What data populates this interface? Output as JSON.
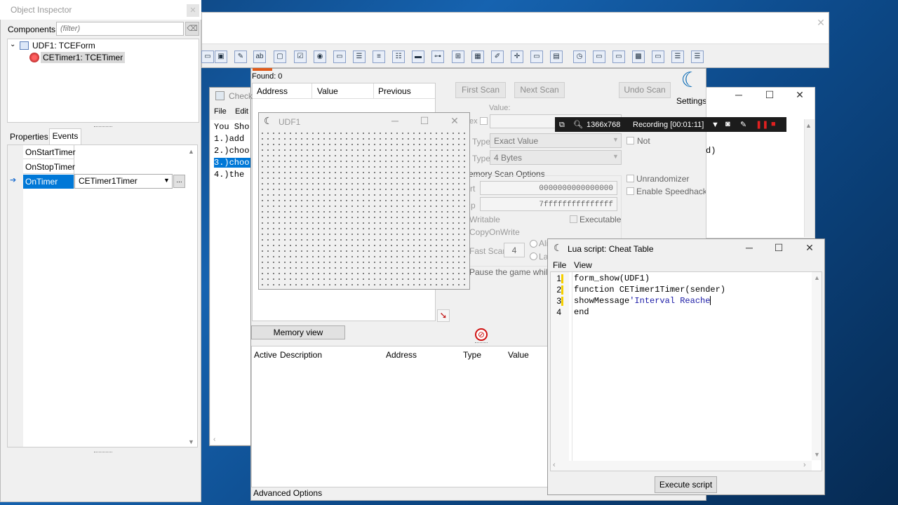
{
  "object_inspector": {
    "title": "Object Inspector",
    "components_label": "Components",
    "filter_placeholder": "(filter)",
    "tree": [
      {
        "label": "UDF1: TCEForm"
      },
      {
        "label": "CETimer1: TCETimer"
      }
    ],
    "tabs": [
      "Properties",
      "Events"
    ],
    "events": [
      {
        "name": "OnStartTimer",
        "value": ""
      },
      {
        "name": "OnStopTimer",
        "value": ""
      },
      {
        "name": "OnTimer",
        "value": "CETimer1Timer"
      }
    ],
    "ellipsis": "..."
  },
  "cheat_engine": {
    "found": "Found: 0",
    "columns": [
      "Address",
      "Value",
      "Previous"
    ],
    "first_scan": "First Scan",
    "next_scan": "Next Scan",
    "undo_scan": "Undo Scan",
    "settings": "Settings",
    "value_label": "Value:",
    "hex_label": "ex",
    "scan_type_label": "Type",
    "scan_type_value": "Exact Value",
    "value_type_label": "Type",
    "value_type_value": "4 Bytes",
    "not_label": "Not",
    "mem_scan_options": "emory Scan Options",
    "unrandomizer": "Unrandomizer",
    "enable_speedhack": "Enable Speedhack",
    "start_label": "rt",
    "start_value": "0000000000000000",
    "stop_label": "p",
    "stop_value": "7fffffffffffffff",
    "writable": "Writable",
    "executable": "Executable",
    "copy_on_write": "CopyOnWrite",
    "fast_scan": "Fast Scan",
    "fast_scan_value": "4",
    "align_opt": "Ali",
    "last_opt": "La",
    "pause_game": "Pause the game while s",
    "memory_view": "Memory view",
    "table_columns": [
      "Active",
      "Description",
      "Address",
      "Type",
      "Value"
    ],
    "advanced_options": "Advanced Options"
  },
  "check_window": {
    "title": "Check",
    "menu": [
      "File",
      "Edit"
    ],
    "lines": [
      "You Sho",
      "1.)add",
      "2.)choo",
      "3.)choo",
      "4.)the"
    ],
    "right_text": "d)"
  },
  "udf1": {
    "title": "UDF1"
  },
  "recorder": {
    "resolution": "1366x768",
    "status": "Recording [00:01:11]"
  },
  "lua": {
    "title": "Lua script: Cheat Table",
    "menu": [
      "File",
      "View"
    ],
    "line_numbers": [
      "1",
      "2",
      "3",
      "4"
    ],
    "lines": {
      "l1": "form_show(UDF1)",
      "l2": "function CETimer1Timer(sender)",
      "l3_code": "showMessage",
      "l3_str": "'Interval Reache",
      "l4": "end"
    },
    "execute": "Execute script"
  },
  "colors": {
    "selection": "#0078d7",
    "lua_string": "#1a1aa6",
    "gutter_mark": "#f5d000"
  }
}
